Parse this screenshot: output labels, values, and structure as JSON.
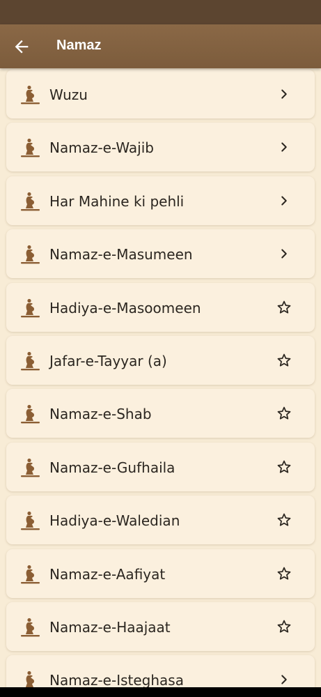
{
  "appbar": {
    "title": "Namaz",
    "back_icon": "arrow-left-icon"
  },
  "items": [
    {
      "label": "Wuzu",
      "trailing": "chevron-right-icon"
    },
    {
      "label": "Namaz-e-Wajib",
      "trailing": "chevron-right-icon"
    },
    {
      "label": "Har Mahine ki pehli",
      "trailing": "chevron-right-icon"
    },
    {
      "label": "Namaz-e-Masumeen",
      "trailing": "chevron-right-icon"
    },
    {
      "label": "Hadiya-e-Masoomeen",
      "trailing": "star-outline-icon"
    },
    {
      "label": "Jafar-e-Tayyar (a)",
      "trailing": "star-outline-icon"
    },
    {
      "label": "Namaz-e-Shab",
      "trailing": "star-outline-icon"
    },
    {
      "label": "Namaz-e-Gufhaila",
      "trailing": "star-outline-icon"
    },
    {
      "label": "Hadiya-e-Waledian",
      "trailing": "star-outline-icon"
    },
    {
      "label": "Namaz-e-Aafiyat",
      "trailing": "star-outline-icon"
    },
    {
      "label": "Namaz-e-Haajaat",
      "trailing": "star-outline-icon"
    },
    {
      "label": "Namaz-e-Isteghasa",
      "trailing": "chevron-right-icon"
    }
  ],
  "colors": {
    "appbar": "#7c5c3c",
    "statusbar": "#5c4530",
    "background": "#f8ecd6",
    "card": "#fbf0de",
    "prayer_icon": "#8b5e34"
  }
}
